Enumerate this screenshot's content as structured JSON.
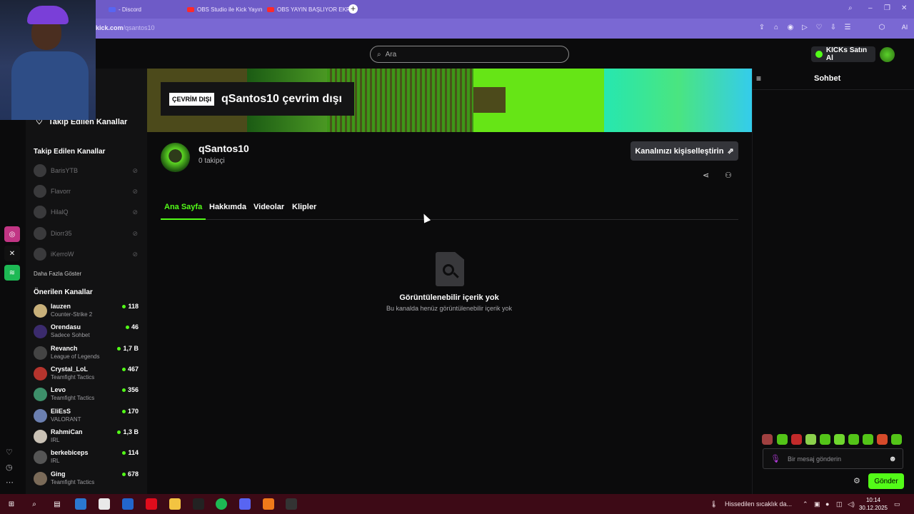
{
  "browser": {
    "tabs": [
      {
        "label": "- Discord"
      },
      {
        "label": "OBS Studio ile Kick Yayın"
      },
      {
        "label": "OBS YAYIN BAŞLIYOR EKR"
      }
    ],
    "url_host": "kick.com",
    "url_path": "/qsantos10",
    "new_tab": "+",
    "ai_label": "AI"
  },
  "topnav": {
    "search_placeholder": "Ara",
    "kicks_button": "KICKs Satın Al"
  },
  "sidebar": {
    "header": "Takip Edilen Kanallar",
    "followed_title": "Takip Edilen Kanallar",
    "followed": [
      {
        "name": "BarisYTB"
      },
      {
        "name": "Flavorr"
      },
      {
        "name": "HilalQ"
      },
      {
        "name": "Diorr35"
      },
      {
        "name": "iKerroW"
      }
    ],
    "show_more": "Daha Fazla Göster",
    "recommended_title": "Önerilen Kanallar",
    "recommended": [
      {
        "name": "lauzen",
        "category": "Counter-Strike 2",
        "viewers": "118"
      },
      {
        "name": "Orendasu",
        "category": "Sadece Sohbet",
        "viewers": "46"
      },
      {
        "name": "Revanch",
        "category": "League of Legends",
        "viewers": "1,7 B"
      },
      {
        "name": "Crystal_LoL",
        "category": "Teamfight Tactics",
        "viewers": "467"
      },
      {
        "name": "Levo",
        "category": "Teamfight Tactics",
        "viewers": "356"
      },
      {
        "name": "EliEsS",
        "category": "VALORANT",
        "viewers": "170"
      },
      {
        "name": "RahmiCan",
        "category": "IRL",
        "viewers": "1,3 B"
      },
      {
        "name": "berkebiceps",
        "category": "IRL",
        "viewers": "114"
      },
      {
        "name": "Ging",
        "category": "Teamfight Tactics",
        "viewers": "678"
      }
    ]
  },
  "banner": {
    "offline_badge": "ÇEVRİM DIŞI",
    "offline_title": "qSantos10 çevrim dışı"
  },
  "channel": {
    "name": "qSantos10",
    "followers": "0 takipçi",
    "customize_button": "Kanalınızı kişiselleştirin"
  },
  "tabs": [
    {
      "label": "Ana Sayfa"
    },
    {
      "label": "Hakkımda"
    },
    {
      "label": "Videolar"
    },
    {
      "label": "Klipler"
    }
  ],
  "empty_state": {
    "title": "Görüntülenebilir içerik yok",
    "subtitle": "Bu kanalda henüz görüntülenebilir içerik yok"
  },
  "chat": {
    "title": "Sohbet",
    "input_placeholder": "Bir mesaj gönderin",
    "send_button": "Gönder"
  },
  "taskbar": {
    "weather": "Hissedilen sıcaklık da...",
    "time": "10:14",
    "date": "30.12.2025"
  },
  "colors": {
    "accent": "#53fc18",
    "tabbar": "#6e5bc7",
    "taskbar": "#3d0a16"
  }
}
